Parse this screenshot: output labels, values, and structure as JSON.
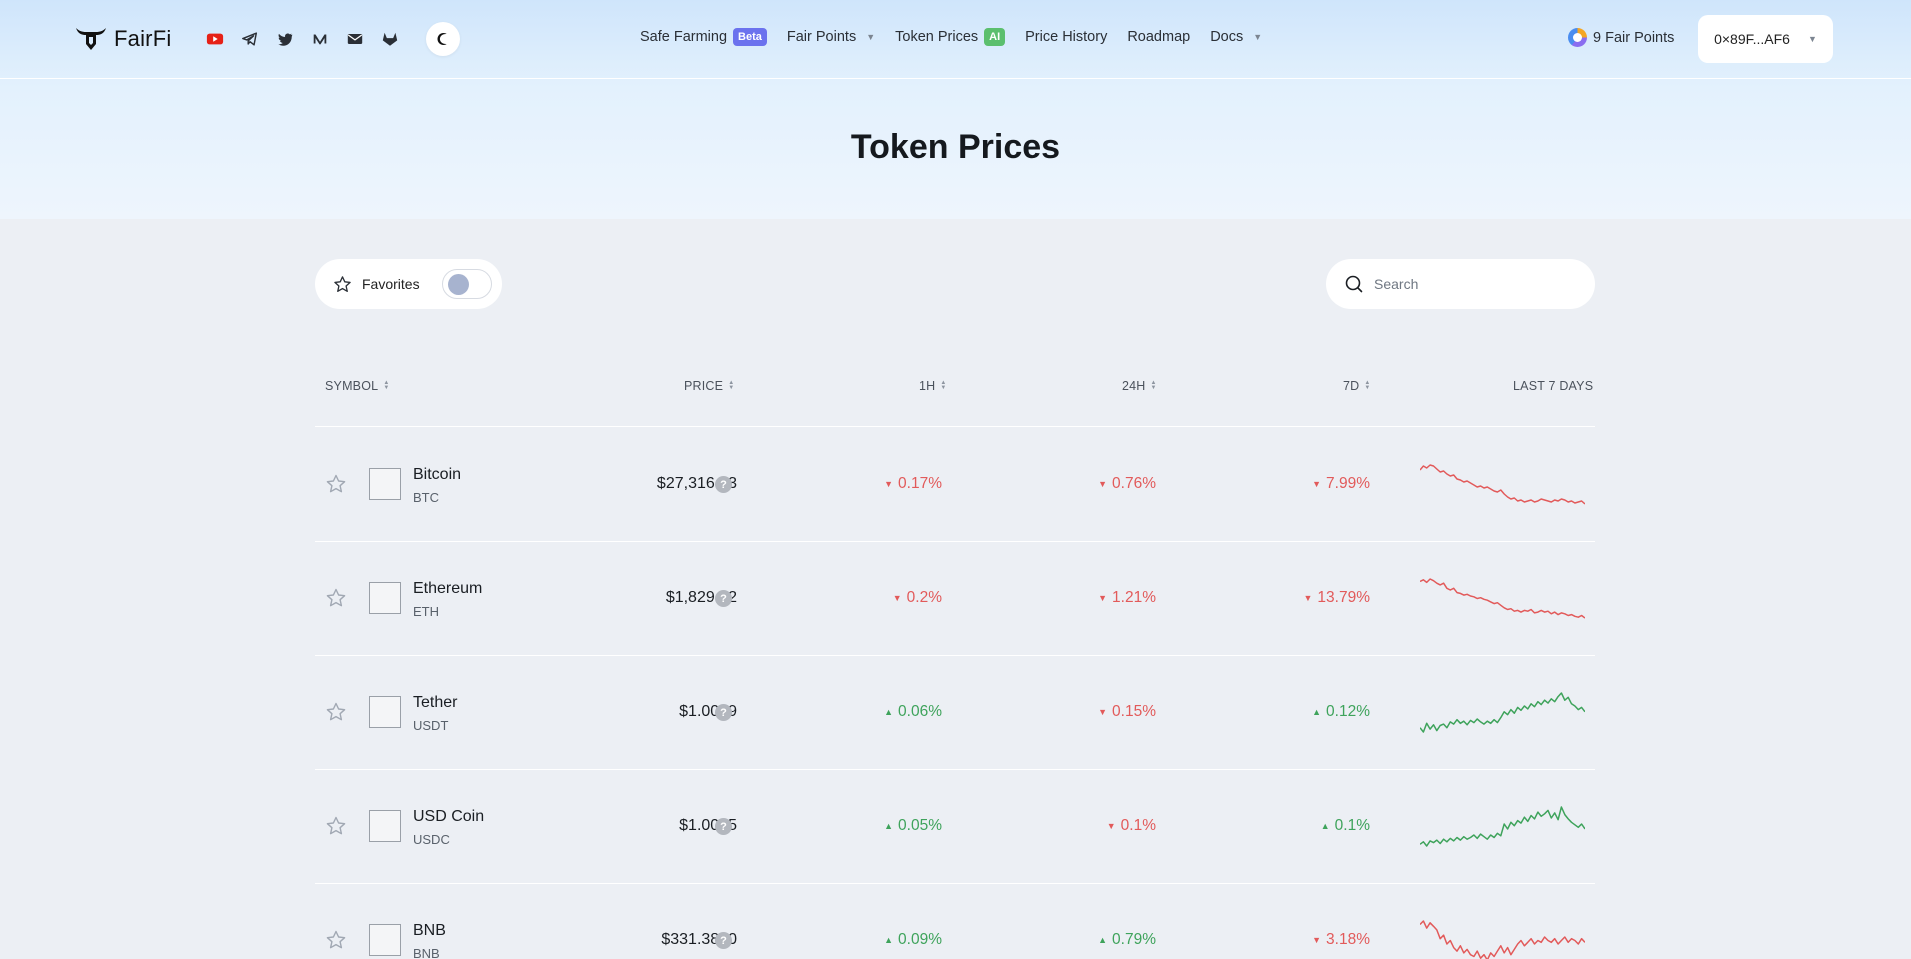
{
  "brand": {
    "name": "FairFi"
  },
  "socials": [
    "youtube-icon",
    "telegram-icon",
    "twitter-icon",
    "medium-icon",
    "mail-icon",
    "gitlab-icon"
  ],
  "nav": {
    "safe_farming": "Safe Farming",
    "safe_farming_badge": "Beta",
    "fair_points": "Fair Points",
    "token_prices": "Token Prices",
    "token_prices_badge": "AI",
    "price_history": "Price History",
    "roadmap": "Roadmap",
    "docs": "Docs"
  },
  "account": {
    "points": "9 Fair Points",
    "wallet": "0×89F...AF6"
  },
  "page": {
    "title": "Token Prices"
  },
  "controls": {
    "favorites_label": "Favorites",
    "search_placeholder": "Search"
  },
  "table": {
    "headers": {
      "symbol": "SYMBOL",
      "price": "PRICE",
      "h1": "1H",
      "h24": "24H",
      "d7": "7D",
      "last7": "LAST 7 DAYS"
    },
    "rows": [
      {
        "name": "Bitcoin",
        "symbol": "BTC",
        "price": "$27,316.43",
        "h1": "0.17%",
        "h1_dir": "down",
        "h24": "0.76%",
        "h24_dir": "down",
        "d7": "7.99%",
        "d7_dir": "down",
        "spark": [
          62,
          66,
          64,
          67,
          66,
          63,
          60,
          61,
          58,
          56,
          57,
          53,
          52,
          50,
          51,
          49,
          47,
          45,
          46,
          44,
          45,
          43,
          41,
          40,
          42,
          38,
          35,
          33,
          34,
          31,
          32,
          30,
          31,
          32,
          30,
          31,
          33,
          32,
          31,
          30,
          32,
          31,
          33,
          32,
          30,
          31,
          29,
          30,
          31,
          28
        ]
      },
      {
        "name": "Ethereum",
        "symbol": "ETH",
        "price": "$1,829.52",
        "h1": "0.2%",
        "h1_dir": "down",
        "h24": "1.21%",
        "h24_dir": "down",
        "d7": "13.79%",
        "d7_dir": "down",
        "spark": [
          68,
          70,
          67,
          71,
          69,
          66,
          64,
          66,
          60,
          58,
          60,
          55,
          54,
          52,
          53,
          51,
          50,
          48,
          49,
          47,
          46,
          44,
          42,
          43,
          40,
          37,
          35,
          36,
          33,
          34,
          32,
          34,
          33,
          35,
          31,
          32,
          34,
          32,
          33,
          30,
          32,
          29,
          31,
          30,
          28,
          29,
          27,
          26,
          28,
          25
        ]
      },
      {
        "name": "Tether",
        "symbol": "USDT",
        "price": "$1.0019",
        "h1": "0.06%",
        "h1_dir": "up",
        "h24": "0.15%",
        "h24_dir": "down",
        "d7": "0.12%",
        "d7_dir": "up",
        "spark": [
          22,
          16,
          28,
          20,
          26,
          18,
          25,
          27,
          22,
          30,
          27,
          33,
          28,
          31,
          26,
          32,
          29,
          34,
          30,
          27,
          31,
          28,
          33,
          29,
          36,
          44,
          40,
          47,
          42,
          50,
          46,
          52,
          48,
          55,
          51,
          58,
          54,
          60,
          56,
          62,
          58,
          65,
          70,
          60,
          64,
          55,
          52,
          47,
          50,
          44
        ]
      },
      {
        "name": "USD Coin",
        "symbol": "USDC",
        "price": "$1.0005",
        "h1": "0.05%",
        "h1_dir": "up",
        "h24": "0.1%",
        "h24_dir": "down",
        "d7": "0.1%",
        "d7_dir": "up",
        "spark": [
          22,
          25,
          20,
          26,
          24,
          27,
          23,
          28,
          25,
          29,
          26,
          30,
          27,
          31,
          28,
          30,
          33,
          29,
          34,
          31,
          28,
          33,
          30,
          35,
          32,
          46,
          40,
          48,
          44,
          50,
          47,
          54,
          49,
          56,
          52,
          60,
          55,
          58,
          62,
          53,
          59,
          51,
          66,
          57,
          52,
          48,
          45,
          42,
          46,
          40
        ]
      },
      {
        "name": "BNB",
        "symbol": "BNB",
        "price": "$331.3800",
        "h1": "0.09%",
        "h1_dir": "up",
        "h24": "0.79%",
        "h24_dir": "up",
        "d7": "3.18%",
        "d7_dir": "down",
        "spark": [
          60,
          62,
          58,
          61,
          59,
          57,
          52,
          54,
          49,
          51,
          47,
          45,
          48,
          44,
          46,
          43,
          42,
          45,
          41,
          43,
          40,
          44,
          42,
          45,
          48,
          44,
          47,
          43,
          46,
          49,
          51,
          48,
          50,
          52,
          49,
          51,
          50,
          53,
          51,
          50,
          52,
          49,
          51,
          53,
          50,
          52,
          51,
          49,
          52,
          50
        ]
      }
    ]
  },
  "colors": {
    "up": "#3ea35b",
    "down": "#e25a5a",
    "beta": "#6b72ee",
    "ai": "#5bbf6e"
  }
}
